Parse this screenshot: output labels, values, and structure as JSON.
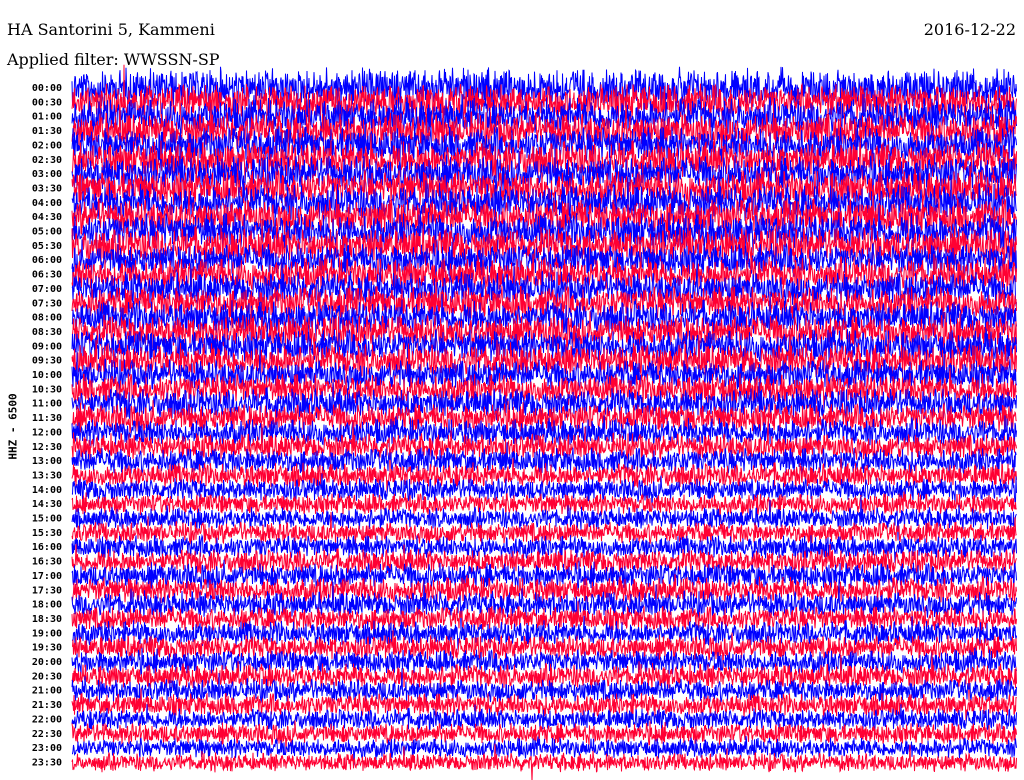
{
  "header": {
    "station": "HA Santorini 5, Kammeni",
    "date": "2016-12-22",
    "filter": "Applied filter: WWSSN-SP"
  },
  "chart_data": {
    "type": "line",
    "title": "HA Santorini 5, Kammeni",
    "ylabel": "HHZ - 6500",
    "series_colors": [
      "#0000ff",
      "#ff0033"
    ],
    "rows": [
      "00:00",
      "00:30",
      "01:00",
      "01:30",
      "02:00",
      "02:30",
      "03:00",
      "03:30",
      "04:00",
      "04:30",
      "05:00",
      "05:30",
      "06:00",
      "06:30",
      "07:00",
      "07:30",
      "08:00",
      "08:30",
      "09:00",
      "09:30",
      "10:00",
      "10:30",
      "11:00",
      "11:30",
      "12:00",
      "12:30",
      "13:00",
      "13:30",
      "14:00",
      "14:30",
      "15:00",
      "15:30",
      "16:00",
      "16:30",
      "17:00",
      "17:30",
      "18:00",
      "18:30",
      "19:00",
      "19:30",
      "20:00",
      "20:30",
      "21:00",
      "21:30",
      "22:00",
      "22:30",
      "23:00",
      "23:30"
    ],
    "relative_amplitude": [
      1.3,
      1.2,
      1.2,
      1.2,
      1.2,
      1.2,
      1.2,
      1.2,
      1.2,
      1.2,
      1.2,
      1.2,
      1.1,
      1.1,
      1.1,
      1.1,
      1.1,
      1.1,
      1.1,
      1.1,
      1.0,
      1.0,
      1.0,
      0.95,
      0.9,
      0.85,
      0.85,
      0.8,
      0.75,
      0.7,
      0.7,
      0.7,
      0.75,
      0.8,
      0.85,
      0.85,
      0.85,
      0.8,
      0.8,
      0.8,
      0.8,
      0.8,
      0.75,
      0.75,
      0.7,
      0.7,
      0.65,
      0.6
    ]
  }
}
